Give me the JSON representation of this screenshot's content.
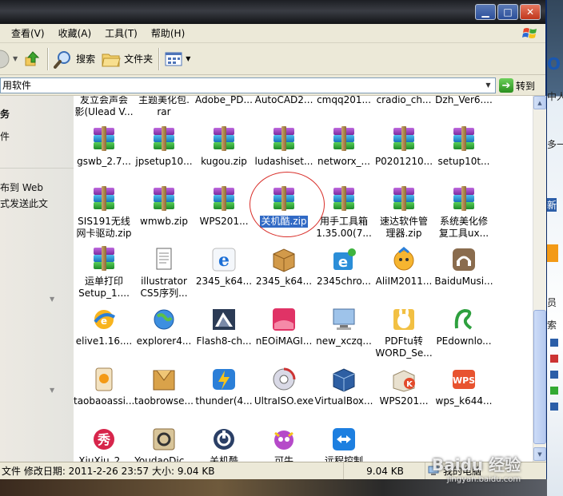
{
  "menu": [
    "查看(V)",
    "收藏(A)",
    "工具(T)",
    "帮助(H)"
  ],
  "toolbar": {
    "search": "搜索",
    "folders": "文件夹"
  },
  "address": {
    "path": "用软件",
    "go": "转到"
  },
  "taskpane": {
    "t1": "务",
    "t2": "件",
    "t3": "布到 Web",
    "t4": "式发送此文"
  },
  "files": [
    {
      "l1": "友立会声会",
      "l2": "影(Ulead V...",
      "icon": "generic-icon"
    },
    {
      "l1": "主题美化包.",
      "l2": "rar",
      "icon": "winrar-icon"
    },
    {
      "l1": "Adobe_PD...",
      "l2": "",
      "icon": "winrar-icon"
    },
    {
      "l1": "AutoCAD2...",
      "l2": "",
      "icon": "winrar-icon"
    },
    {
      "l1": "cmqq201...",
      "l2": "",
      "icon": "winrar-icon"
    },
    {
      "l1": "cradio_ch...",
      "l2": "",
      "icon": "winrar-icon"
    },
    {
      "l1": "Dzh_Ver6....",
      "l2": "",
      "icon": "winrar-icon"
    },
    {
      "l1": "gswb_2.7...",
      "l2": "",
      "icon": "winrar-icon"
    },
    {
      "l1": "jpsetup10...",
      "l2": "",
      "icon": "winrar-icon"
    },
    {
      "l1": "kugou.zip",
      "l2": "",
      "icon": "winrar-icon"
    },
    {
      "l1": "ludashiset...",
      "l2": "",
      "icon": "winrar-icon"
    },
    {
      "l1": "networx_...",
      "l2": "",
      "icon": "winrar-icon"
    },
    {
      "l1": "P0201210...",
      "l2": "",
      "icon": "winrar-icon"
    },
    {
      "l1": "setup10t...",
      "l2": "",
      "icon": "winrar-icon"
    },
    {
      "l1": "SIS191无线",
      "l2": "网卡驱动.zip",
      "icon": "winrar-icon"
    },
    {
      "l1": "wmwb.zip",
      "l2": "",
      "icon": "winrar-icon"
    },
    {
      "l1": "WPS201...",
      "l2": "",
      "icon": "winrar-icon"
    },
    {
      "l1": "关机酷.zip",
      "l2": "",
      "icon": "winrar-icon",
      "selected": true
    },
    {
      "l1": "用手工具箱",
      "l2": "1.35.00(7...",
      "icon": "winrar-icon"
    },
    {
      "l1": "速达软件管",
      "l2": "理器.zip",
      "icon": "winrar-icon"
    },
    {
      "l1": "系统美化修",
      "l2": "复工具ux...",
      "icon": "winrar-icon"
    },
    {
      "l1": "运单打印",
      "l2": "Setup_1....",
      "icon": "winrar-icon"
    },
    {
      "l1": "illustrator",
      "l2": "CS5序列...",
      "icon": "notepad-icon"
    },
    {
      "l1": "2345_k64...",
      "l2": "",
      "icon": "ie-icon"
    },
    {
      "l1": "2345_k64...",
      "l2": "",
      "icon": "box-icon"
    },
    {
      "l1": "2345chro...",
      "l2": "",
      "icon": "browser-icon"
    },
    {
      "l1": "AliIM2011...",
      "l2": "",
      "icon": "aliim-icon"
    },
    {
      "l1": "BaiduMusi...",
      "l2": "",
      "icon": "baidu-music-icon"
    },
    {
      "l1": "elive1.16....",
      "l2": "",
      "icon": "elive-icon"
    },
    {
      "l1": "explorer4...",
      "l2": "",
      "icon": "explorer-icon"
    },
    {
      "l1": "Flash8-ch...",
      "l2": "",
      "icon": "flash-icon"
    },
    {
      "l1": "nEOiMAGI...",
      "l2": "",
      "icon": "neoimaging-icon"
    },
    {
      "l1": "new_xczq...",
      "l2": "",
      "icon": "computer-icon"
    },
    {
      "l1": "PDFtu转",
      "l2": "WORD_Se...",
      "icon": "pdf-icon"
    },
    {
      "l1": "PEdownlo...",
      "l2": "",
      "icon": "pe-icon"
    },
    {
      "l1": "taobaoassi...",
      "l2": "",
      "icon": "taobao-icon"
    },
    {
      "l1": "taobrowse...",
      "l2": "",
      "icon": "taobrowser-icon"
    },
    {
      "l1": "thunder(4...",
      "l2": "",
      "icon": "thunder-icon"
    },
    {
      "l1": "UltraISO.exe",
      "l2": "",
      "icon": "ultraiso-icon"
    },
    {
      "l1": "VirtualBox...",
      "l2": "",
      "icon": "virtualbox-icon"
    },
    {
      "l1": "WPS201...",
      "l2": "",
      "icon": "wps-installer-icon"
    },
    {
      "l1": "wps_k644...",
      "l2": "",
      "icon": "wps-icon"
    },
    {
      "l1": "XiuXiu_2...",
      "l2": "",
      "icon": "xiuxiu-icon"
    },
    {
      "l1": "YoudaoDic...",
      "l2": "",
      "icon": "youdao-icon"
    },
    {
      "l1": "关机酷",
      "l2": "",
      "icon": "shutdown-icon"
    },
    {
      "l1": "可牛",
      "l2": "",
      "icon": "keniu-icon"
    },
    {
      "l1": "远程控制",
      "l2": "",
      "icon": "teamviewer-icon"
    }
  ],
  "status": {
    "info": "文件 修改日期: 2011-2-26 23:57 大小: 9.04 KB",
    "size": "9.04 KB",
    "zone": "我的电脑"
  },
  "watermark": {
    "brand": "Baidu 经验",
    "url": "jingyan.baidu.com"
  },
  "background": {
    "f1": "中人",
    "f2": "多一",
    "f3": "新",
    "f4": "员",
    "f5": "索"
  }
}
